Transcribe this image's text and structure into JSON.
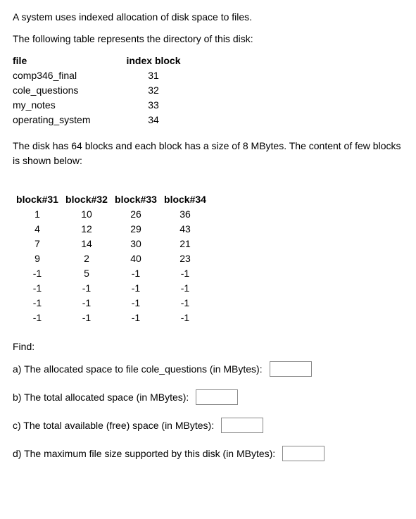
{
  "intro": {
    "line1": "A system uses indexed allocation of disk space to files.",
    "line2": "The following table represents the directory of this disk:"
  },
  "dirTable": {
    "hdr_file": "file",
    "hdr_index": "index block",
    "rows": [
      {
        "file": "comp346_final",
        "idx": "31"
      },
      {
        "file": "cole_questions",
        "idx": "32"
      },
      {
        "file": "my_notes",
        "idx": "33"
      },
      {
        "file": "operating_system",
        "idx": "34"
      }
    ]
  },
  "mid": {
    "line": "The disk has 64 blocks and each block has a size of 8 MBytes. The content of few blocks is shown below:"
  },
  "blocksTable": {
    "hdrs": [
      "block#31",
      "block#32",
      "block#33",
      "block#34"
    ],
    "rows": [
      [
        "1",
        "10",
        "26",
        "36"
      ],
      [
        "4",
        "12",
        "29",
        "43"
      ],
      [
        "7",
        "14",
        "30",
        "21"
      ],
      [
        "9",
        "2",
        "40",
        "23"
      ],
      [
        "-1",
        "5",
        "-1",
        "-1"
      ],
      [
        "-1",
        "-1",
        "-1",
        "-1"
      ],
      [
        "-1",
        "-1",
        "-1",
        "-1"
      ],
      [
        "-1",
        "-1",
        "-1",
        "-1"
      ]
    ]
  },
  "find": {
    "label": "Find:",
    "qa": "a) The allocated space to file cole_questions (in MBytes):",
    "qb": "b) The total allocated space (in MBytes):",
    "qc": "c) The total available (free) space (in MBytes):",
    "qd": "d) The maximum file size supported by this disk (in MBytes):"
  }
}
